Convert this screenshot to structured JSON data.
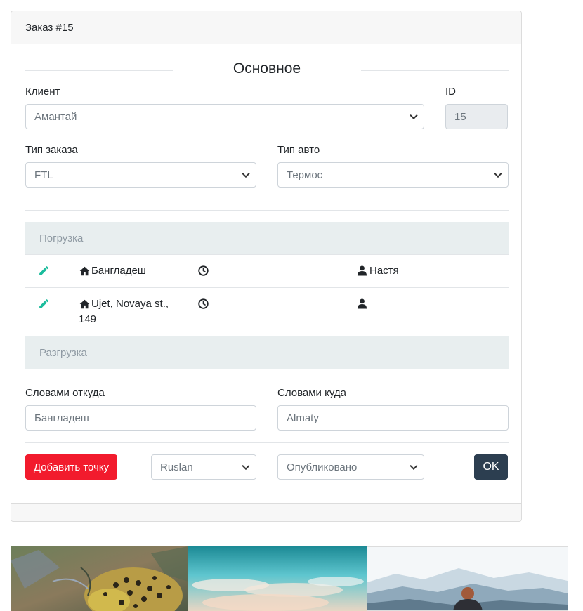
{
  "order": {
    "title": "Заказ #15"
  },
  "section": {
    "title": "Основное"
  },
  "client": {
    "label": "Клиент",
    "value": "Амантай"
  },
  "id_field": {
    "label": "ID",
    "value": "15"
  },
  "order_type": {
    "label": "Тип заказа",
    "value": "FTL"
  },
  "car_type": {
    "label": "Тип авто",
    "value": "Термос"
  },
  "loading": {
    "label": "Погрузка",
    "rows": [
      {
        "address": "Бангладеш",
        "contact": "Настя"
      },
      {
        "address_line1": "Ujet, Novaya st.,",
        "address_line2": "149",
        "contact": ""
      }
    ]
  },
  "unloading": {
    "label": "Разгрузка"
  },
  "from_words": {
    "label": "Словами откуда",
    "placeholder": "Бангладеш"
  },
  "to_words": {
    "label": "Словами куда",
    "placeholder": "Almaty"
  },
  "actions": {
    "add_point": "Добавить точку",
    "user_select": "Ruslan",
    "status_select": "Опубликовано",
    "ok": "OK"
  },
  "colors": {
    "accent_green": "#1abc9c",
    "danger": "#f21b2d",
    "dark": "#2c3e50"
  },
  "icons": [
    "pencil-icon",
    "home-icon",
    "clock-icon",
    "user-icon",
    "chevron-down-icon"
  ]
}
